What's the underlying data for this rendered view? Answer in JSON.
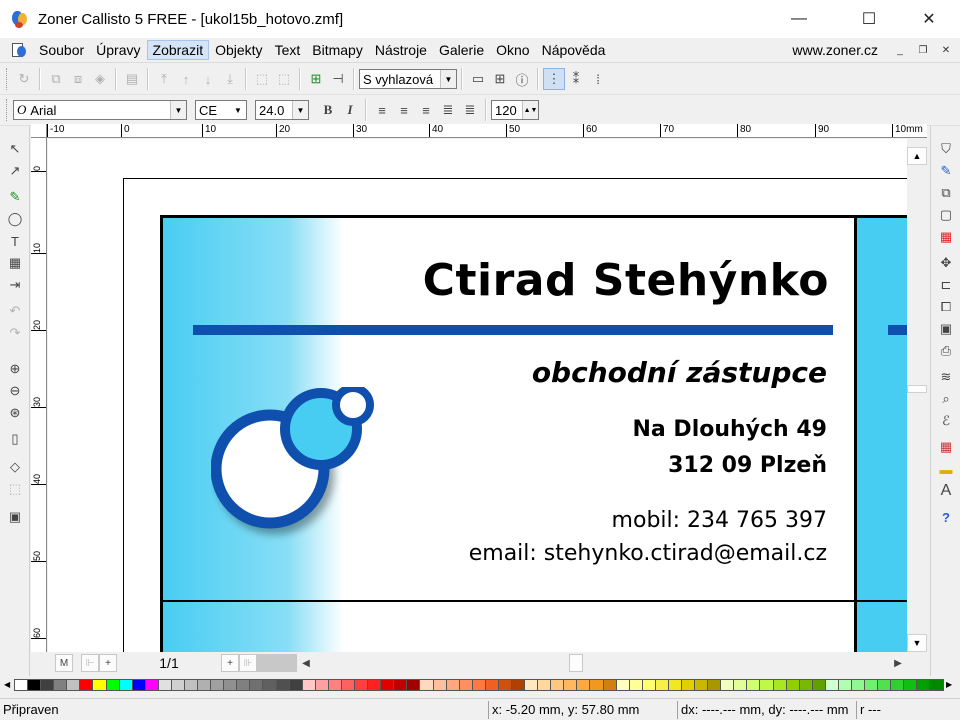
{
  "window": {
    "title": "Zoner Callisto 5 FREE - [ukol15b_hotovo.zmf]",
    "minimize_glyph": "—",
    "maximize_glyph": "☐",
    "close_glyph": "✕"
  },
  "menu": {
    "items": [
      "Soubor",
      "Úpravy",
      "Zobrazit",
      "Objekty",
      "Text",
      "Bitmapy",
      "Nástroje",
      "Galerie",
      "Okno",
      "Nápověda"
    ],
    "active": "Zobrazit",
    "website": "www.zoner.cz"
  },
  "toolbar1": {
    "display_mode": "S vyhlazová"
  },
  "toolbar2": {
    "font": "Arial",
    "charset": "CE",
    "font_size": "24.0",
    "bold": "B",
    "italic": "I",
    "line_spacing": "120"
  },
  "rulers": {
    "horizontal": [
      "-10",
      "0",
      "10",
      "20",
      "30",
      "40",
      "50",
      "60",
      "70",
      "80",
      "90",
      "10mm"
    ],
    "vertical": [
      "0",
      "10",
      "20",
      "30",
      "40",
      "50",
      "60"
    ]
  },
  "card": {
    "name": "Ctirad Stehýnko",
    "role": "obchodní zástupce",
    "street": "Na Dlouhých 49",
    "city": "312 09 Plzeň",
    "phone": "mobil: 234 765 397",
    "email": "email: stehynko.ctirad@email.cz"
  },
  "pager": {
    "page": "1/1"
  },
  "palette": [
    "#ffffff",
    "#000000",
    "#404040",
    "#808080",
    "#c0c0c0",
    "#ff0000",
    "#ffff00",
    "#00ff00",
    "#00ffff",
    "#0000ff",
    "#ff00ff",
    "#e0e0e0",
    "#d0d0d0",
    "#c0c0c0",
    "#b0b0b0",
    "#a0a0a0",
    "#909090",
    "#808080",
    "#707070",
    "#606060",
    "#505050",
    "#404040",
    "#ffc8c8",
    "#ffa0a0",
    "#ff8080",
    "#ff6060",
    "#ff4040",
    "#ff2020",
    "#e00000",
    "#c00000",
    "#a00000",
    "#ffd8c0",
    "#ffc0a0",
    "#ffa880",
    "#ff9060",
    "#ff7840",
    "#f06020",
    "#d05010",
    "#b04000",
    "#ffe8c0",
    "#ffd8a0",
    "#ffc880",
    "#ffb860",
    "#ffa840",
    "#f09820",
    "#d08010",
    "#ffffc0",
    "#ffff98",
    "#ffff70",
    "#f8f048",
    "#f0e820",
    "#e0d000",
    "#c8b800",
    "#a89800",
    "#f0ffc0",
    "#e0ff98",
    "#d0ff70",
    "#c0f848",
    "#a8e820",
    "#90d000",
    "#78b800",
    "#60a000",
    "#d0ffd0",
    "#b0ffb0",
    "#90f890",
    "#70f070",
    "#50e050",
    "#30d030",
    "#10c010",
    "#00a000",
    "#008800"
  ],
  "status": {
    "state": "Připraven",
    "coords": "x: -5.20 mm, y: 57.80 mm",
    "delta": "dx: ----.--- mm, dy: ----.--- mm",
    "r": "r ---"
  }
}
